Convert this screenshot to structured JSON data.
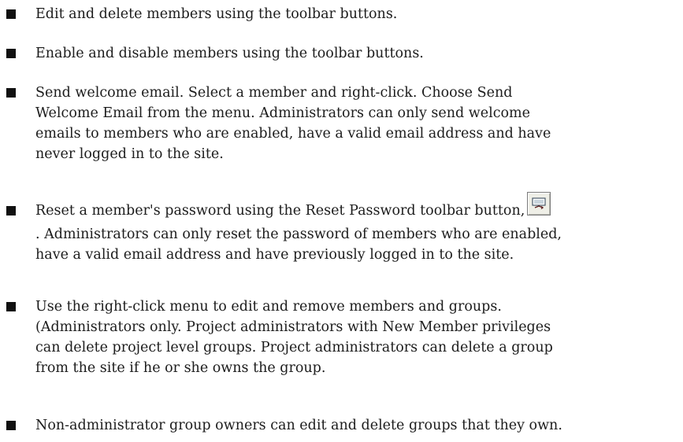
{
  "items": [
    {
      "lines": [
        "Edit and delete members using the toolbar buttons."
      ]
    },
    {
      "lines": [
        "Enable and disable members using the toolbar buttons."
      ]
    },
    {
      "lines": [
        "Send welcome email. Select a member and right-click. Choose Send",
        "Welcome Email from the menu. Administrators can only send welcome",
        "emails to members who are enabled, have a valid email address and have",
        "never logged in to the site."
      ]
    },
    {
      "lines": [
        "Reset a member's password using the Reset Password toolbar button,",
        ". Administrators can only reset the password of members who are enabled,",
        "have a valid email address and have previously logged in to the site."
      ],
      "icon": "reset-password-icon"
    },
    {
      "lines": [
        "Use the right-click menu to edit and remove members and groups.",
        "(Administrators only. Project administrators with New Member privileges",
        "can delete project level groups. Project administrators can delete a group",
        "from the site if he or she owns the group."
      ]
    },
    {
      "lines": [
        "Non-administrator group owners can edit and delete groups that they own."
      ]
    }
  ]
}
